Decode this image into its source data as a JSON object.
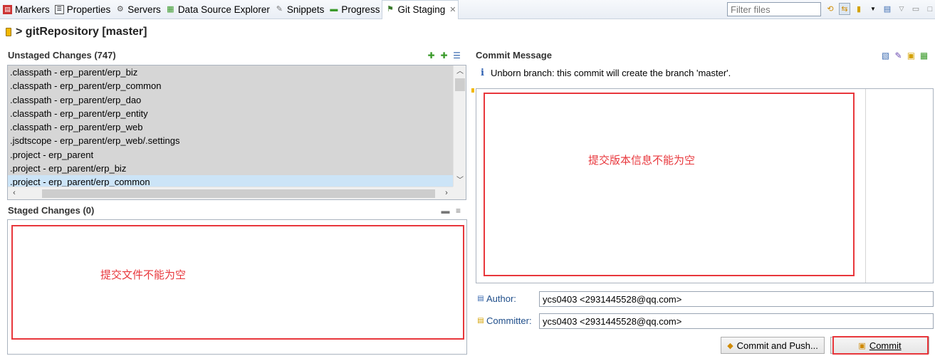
{
  "tabs": [
    {
      "label": "Markers",
      "icon": "markers-icon"
    },
    {
      "label": "Properties",
      "icon": "properties-icon"
    },
    {
      "label": "Servers",
      "icon": "servers-icon"
    },
    {
      "label": "Data Source Explorer",
      "icon": "data-source-icon"
    },
    {
      "label": "Snippets",
      "icon": "snippets-icon"
    },
    {
      "label": "Progress",
      "icon": "progress-icon"
    },
    {
      "label": "Git Staging",
      "icon": "git-staging-icon",
      "active": true
    }
  ],
  "filter": {
    "placeholder": "Filter files"
  },
  "header": {
    "title": "> gitRepository [master]"
  },
  "unstaged": {
    "title": "Unstaged Changes (747)",
    "items": [
      ".classpath - erp_parent/erp_biz",
      ".classpath - erp_parent/erp_common",
      ".classpath - erp_parent/erp_dao",
      ".classpath - erp_parent/erp_entity",
      ".classpath - erp_parent/erp_web",
      ".jsdtscope - erp_parent/erp_web/.settings",
      ".project - erp_parent",
      ".project - erp_parent/erp_biz",
      ".project - erp_parent/erp_common"
    ]
  },
  "staged": {
    "title": "Staged Changes (0)",
    "annotation": "提交文件不能为空"
  },
  "commit": {
    "title": "Commit Message",
    "info": "Unborn branch: this commit will create the branch 'master'.",
    "annotation": "提交版本信息不能为空",
    "author_label": "Author:",
    "author_value": "ycs0403 <2931445528@qq.com>",
    "committer_label": "Committer:",
    "committer_value": "ycs0403 <2931445528@qq.com>",
    "commit_push_label": "Commit and Push...",
    "commit_label": "Commit"
  },
  "colors": {
    "annotation": "#e8373c",
    "selection": "#cce4f7",
    "list_bg": "#d6d6d6"
  }
}
